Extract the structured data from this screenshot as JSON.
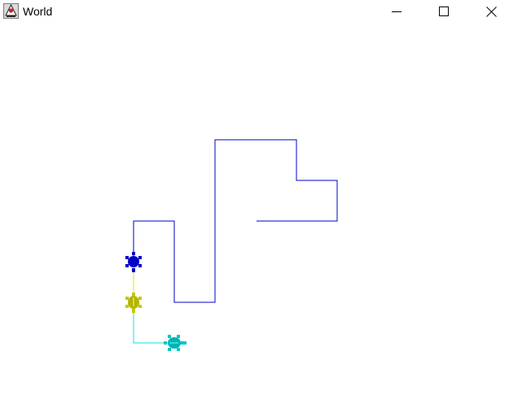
{
  "window": {
    "title": "World",
    "icon": "java-duke-icon",
    "controls": [
      "minimize-icon",
      "maximize-icon",
      "close-icon"
    ]
  },
  "world": {
    "background": "#ffffff",
    "turtles": [
      {
        "name": "blue-turtle",
        "color": "#0000c8",
        "heading": "north"
      },
      {
        "name": "yellow-turtle",
        "color": "#c8c800",
        "heading": "south"
      },
      {
        "name": "cyan-turtle",
        "color": "#00c8c8",
        "heading": "east"
      }
    ],
    "trail_colors": {
      "blue": "#0000c8",
      "yellow": "#e6e600",
      "cyan": "#00e6e6"
    }
  }
}
